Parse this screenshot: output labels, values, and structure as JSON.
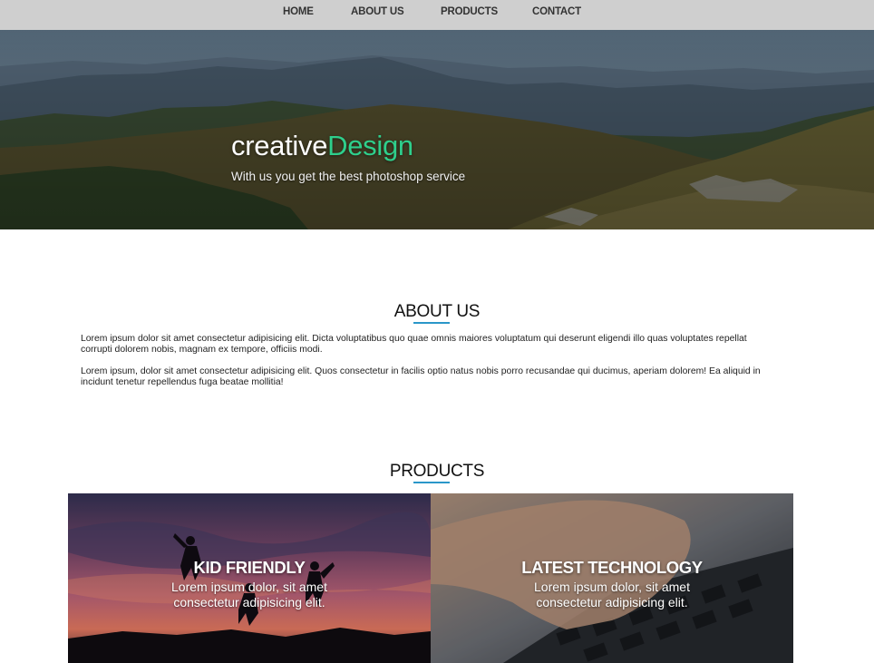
{
  "nav": {
    "items": [
      {
        "label": "HOME"
      },
      {
        "label": "ABOUT US"
      },
      {
        "label": "PRODUCTS"
      },
      {
        "label": "CONTACT"
      }
    ]
  },
  "hero": {
    "title_part1": "creative",
    "title_part2": "Design",
    "subtitle": "With us you get the best photoshop service",
    "accent_color": "#2ecf8c"
  },
  "about": {
    "title": "ABOUT US",
    "paragraphs": [
      "Lorem ipsum dolor sit amet consectetur adipisicing elit. Dicta voluptatibus quo quae omnis maiores voluptatum qui deserunt eligendi illo quas voluptates repellat corrupti dolorem nobis, magnam ex tempore, officiis modi.",
      "Lorem ipsum, dolor sit amet consectetur adipisicing elit. Quos consectetur in facilis optio natus nobis porro recusandae qui ducimus, aperiam dolorem! Ea aliquid in incidunt tenetur repellendus fuga beatae mollitia!"
    ]
  },
  "products": {
    "title": "PRODUCTS",
    "underline_color": "#2a97c9",
    "items": [
      {
        "title": "KID FRIENDLY",
        "description": "Lorem ipsum dolor, sit amet consectetur adipisicing elit."
      },
      {
        "title": "LATEST TECHNOLOGY",
        "description": "Lorem ipsum dolor, sit amet consectetur adipisicing elit."
      }
    ]
  }
}
